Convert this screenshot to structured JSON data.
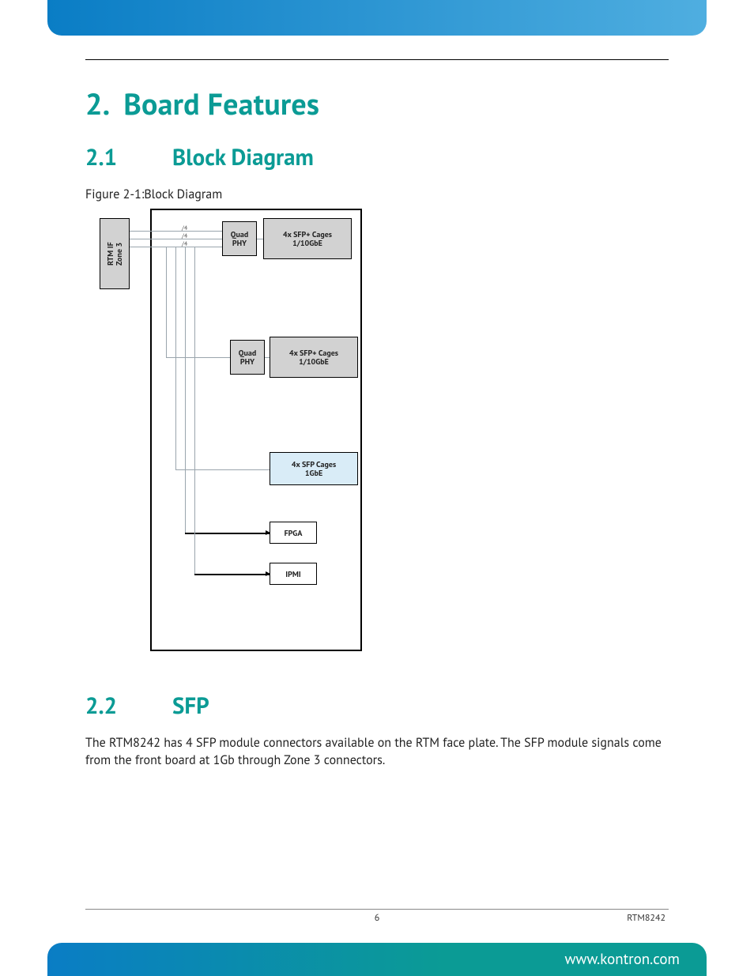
{
  "header": {},
  "chapter": {
    "number": "2.",
    "title": "Board Features"
  },
  "section1": {
    "number": "2.1",
    "title": "Block Diagram"
  },
  "figure": {
    "caption": "Figure 2-1:Block Diagram"
  },
  "diagram": {
    "rtm_if": "RTM IF\nZone 3",
    "quad_phy_1": "Quad\nPHY",
    "sfpplus_1_line1": "4x SFP+ Cages",
    "sfpplus_1_line2": "1/10GbE",
    "quad_phy_2": "Quad\nPHY",
    "sfpplus_2_line1": "4x SFP+ Cages",
    "sfpplus_2_line2": "1/10GbE",
    "sfp_line1": "4x SFP Cages",
    "sfp_line2": "1GbE",
    "fpga": "FPGA",
    "ipmi": "IPMI",
    "lane_label": "/4"
  },
  "section2": {
    "number": "2.2",
    "title": "SFP"
  },
  "body": {
    "sfp_paragraph": "The RTM8242 has 4 SFP module connectors available on the RTM face plate. The SFP module signals come from the front board at 1Gb through Zone 3 connectors."
  },
  "footer": {
    "page": "6",
    "docid": "RTM8242",
    "url": "www.kontron.com"
  }
}
